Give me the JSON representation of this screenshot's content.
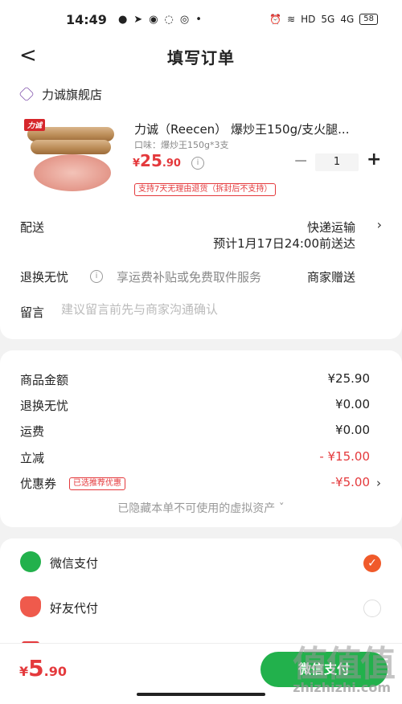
{
  "status_bar": {
    "time": "14:49",
    "icons": [
      "wechat-icon",
      "telegram-icon",
      "weibo-icon",
      "chat-icon",
      "browser-icon",
      "dot-icon"
    ],
    "right_icons": [
      "alarm-icon",
      "wifi-icon",
      "hd-icon",
      "signal-5g-icon",
      "signal-4g-icon"
    ],
    "hd_label": "HD",
    "sig1": "5G",
    "sig2": "4G",
    "battery": "58"
  },
  "nav": {
    "back_glyph": "<",
    "title": "填写订单"
  },
  "store": {
    "name": "力诚旗舰店"
  },
  "product": {
    "brand_tag": "力诚",
    "title": "力诚（Reecen） 爆炒王150g/支火腿...",
    "spec": "口味：爆炒王150g*3支",
    "price_currency": "¥",
    "price_int": "25",
    "price_dec": ".90",
    "quantity": "1",
    "minus": "−",
    "plus": "+",
    "return_tag": "支持7天无理由退货（拆封后不支持）"
  },
  "shipping": {
    "label": "配送",
    "method": "快递运输",
    "eta": "预计1月17日24:00前送达"
  },
  "return_service": {
    "label": "退换无忧",
    "desc": "享运费补贴或免费取件服务",
    "value": "商家赠送"
  },
  "message": {
    "label": "留言",
    "placeholder": "建议留言前先与商家沟通确认"
  },
  "summary": {
    "rows": [
      {
        "label": "商品金额",
        "value": "¥25.90"
      },
      {
        "label": "退换无忧",
        "value": "¥0.00"
      },
      {
        "label": "运费",
        "value": "¥0.00"
      },
      {
        "label": "立减",
        "value": "- ¥15.00"
      },
      {
        "label": "优惠券",
        "value": "-¥5.00"
      }
    ],
    "coupon_tag": "已选推荐优惠",
    "hidden_note": "已隐藏本单不可使用的虚拟资产 ˇ"
  },
  "payment": {
    "methods": [
      {
        "label": "微信支付",
        "selected": true
      },
      {
        "label": "好友代付",
        "selected": false
      }
    ]
  },
  "bottom": {
    "total_currency": "¥",
    "total_int": "5",
    "total_dec": ".90",
    "pay_button": "微信支付"
  },
  "watermark": {
    "logo": "值值值",
    "url": "zhizhizhi.com"
  },
  "colors": {
    "accent_red": "#e4393c",
    "wechat_green": "#22b14c",
    "selected_orange": "#f05a2a"
  }
}
